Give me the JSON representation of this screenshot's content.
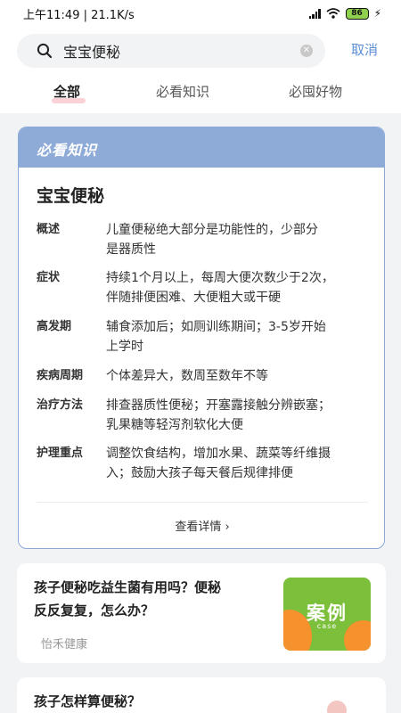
{
  "status_bar": {
    "time": "上午11:49",
    "speed": "21.1K/s",
    "battery": "86"
  },
  "search": {
    "query": "宝宝便秘",
    "cancel_label": "取消"
  },
  "tabs": [
    {
      "label": "全部",
      "active": true
    },
    {
      "label": "必看知识",
      "active": false
    },
    {
      "label": "必囤好物",
      "active": false
    }
  ],
  "knowledge": {
    "banner": "必看知识",
    "title": "宝宝便秘",
    "rows": [
      {
        "label": "概述",
        "line1": "儿童便秘绝大部分是功能性的，少部分",
        "line2": "是器质性"
      },
      {
        "label": "症状",
        "line1": "持续1个月以上，每周大便次数少于2次，",
        "line2": "伴随排便困难、大便粗大或干硬"
      },
      {
        "label": "高发期",
        "line1": "辅食添加后；如厕训练期间；3-5岁开始",
        "line2": "上学时"
      },
      {
        "label": "疾病周期",
        "line1": "个体差异大，数周至数年不等",
        "line2": ""
      },
      {
        "label": "治疗方法",
        "line1": "排查器质性便秘；开塞露接触分辨嵌塞；",
        "line2": "乳果糖等轻泻剂软化大便"
      },
      {
        "label": "护理重点",
        "line1": "调整饮食结构，增加水果、蔬菜等纤维摄",
        "line2": "入；鼓励大孩子每天餐后规律排便"
      }
    ],
    "more_label": "查看详情 ›"
  },
  "articles": [
    {
      "title_line1": "孩子便秘吃益生菌有用吗？便秘",
      "title_line2": "反反复复，怎么办？",
      "source": "怡禾健康",
      "thumb_text": "案例",
      "thumb_sub": "case"
    },
    {
      "title_line1": "孩子怎样算便秘？"
    }
  ],
  "colors": {
    "accent": "#5b8ed6",
    "banner": "#8eabd8",
    "tab_underline": "#f9c9cf",
    "thumb_green": "#7bbf3a",
    "thumb_orange": "#f5922e"
  }
}
